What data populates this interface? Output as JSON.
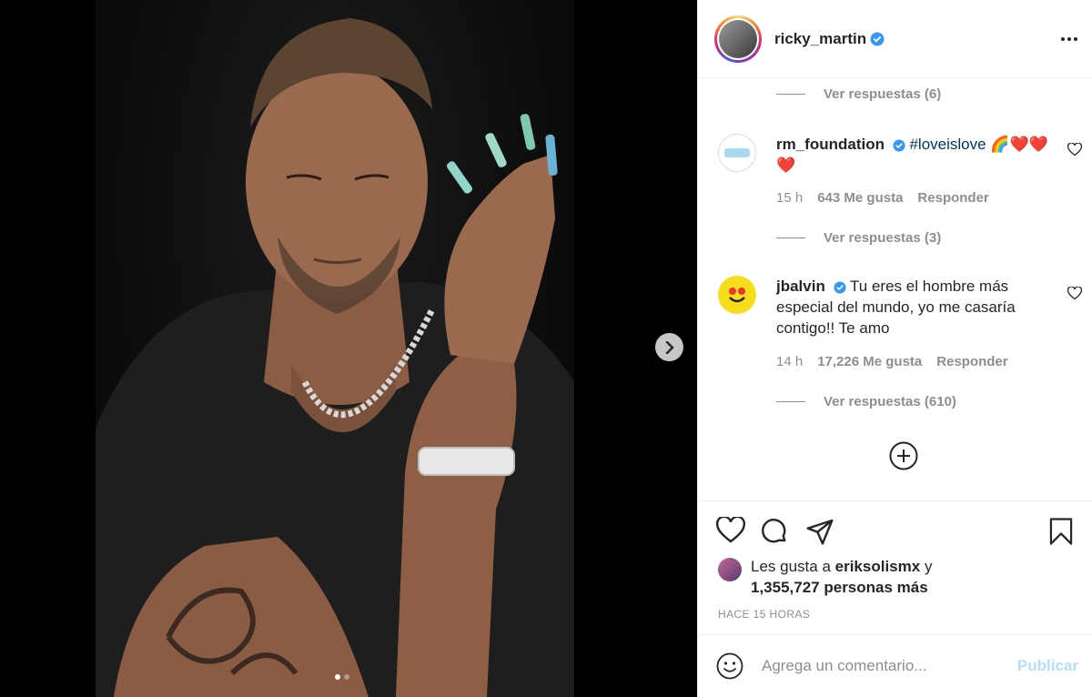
{
  "post": {
    "username": "ricky_martin",
    "media": {
      "slide_count": 2,
      "active_slide": 1
    }
  },
  "comments": {
    "replies_first": "Ver respuestas (6)",
    "items": [
      {
        "user": "rm_foundation",
        "text": "#loveislove",
        "emoji": "🌈❤️❤️❤️",
        "time": "15 h",
        "likes": "643 Me gusta",
        "reply": "Responder",
        "view_replies": "Ver respuestas (3)"
      },
      {
        "user": "jbalvin",
        "text": "Tu eres el hombre más especial del mundo, yo me casaría contigo!! Te amo",
        "time": "14 h",
        "likes": "17,226 Me gusta",
        "reply": "Responder",
        "view_replies": "Ver respuestas (610)"
      }
    ]
  },
  "likes": {
    "prefix": "Les gusta a",
    "user": "eriksolismx",
    "joiner": "y",
    "count_text": "1,355,727 personas más"
  },
  "time_ago": "HACE 15 HORAS",
  "composer": {
    "placeholder": "Agrega un comentario...",
    "post_label": "Publicar"
  },
  "colors": {
    "verified": "#3897f0",
    "hashtag": "#00376b",
    "muted": "#8e8e8e",
    "post_disabled": "#b2dffc"
  }
}
